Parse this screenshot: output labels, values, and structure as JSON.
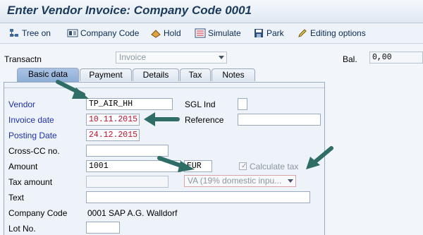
{
  "window": {
    "title": "Enter Vendor Invoice: Company Code 0001"
  },
  "toolbar": {
    "tree_on": "Tree on",
    "company_code": "Company Code",
    "hold": "Hold",
    "simulate": "Simulate",
    "park": "Park",
    "editing_options": "Editing options"
  },
  "header": {
    "transactn_label": "Transactn",
    "transactn_value": "Invoice",
    "bal_label": "Bal.",
    "bal_value": "0,00"
  },
  "tabs": [
    "Basic data",
    "Payment",
    "Details",
    "Tax",
    "Notes"
  ],
  "form": {
    "vendor_label": "Vendor",
    "vendor_value": "TP_AIR_HH",
    "sgl_label": "SGL Ind",
    "invoice_date_label": "Invoice date",
    "invoice_date_value": "10.11.2015",
    "reference_label": "Reference",
    "posting_date_label": "Posting Date",
    "posting_date_value": "24.12.2015",
    "cross_cc_label": "Cross-CC no.",
    "amount_label": "Amount",
    "amount_value": "1001",
    "currency_value": "EUR",
    "calc_tax_label": "Calculate tax",
    "tax_amount_label": "Tax amount",
    "tax_code_value": "VA (19% domestic inpu...",
    "text_label": "Text",
    "company_code_label": "Company Code",
    "company_code_value": "0001 SAP A.G. Walldorf",
    "lot_no_label": "Lot No."
  },
  "colors": {
    "label_blue": "#1d2fb5",
    "date_red": "#c8102e",
    "arrow_teal": "#2f6e66",
    "tab_active": "#a9c3e3"
  },
  "icons": [
    "tree-icon",
    "company-code-icon",
    "hold-icon",
    "simulate-icon",
    "park-icon",
    "pencil-icon",
    "annotation-arrow"
  ]
}
